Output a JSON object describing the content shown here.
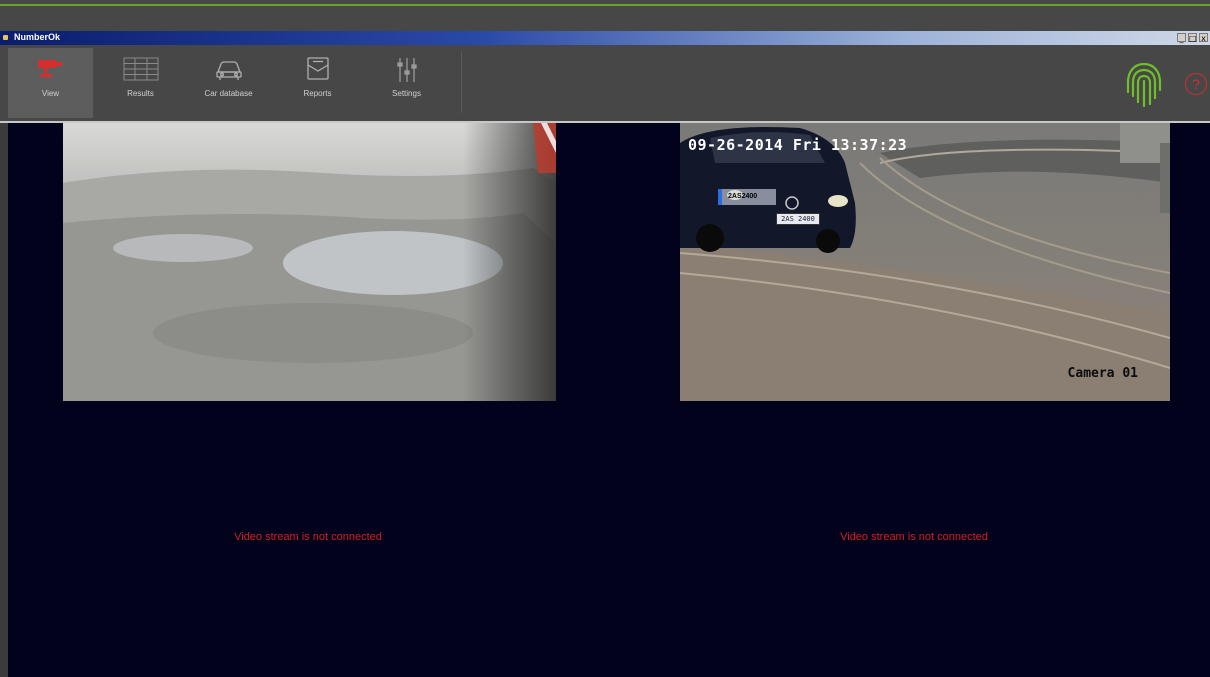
{
  "window": {
    "title": "NumberOk",
    "min": "_",
    "max": "□",
    "close": "x"
  },
  "toolbar": {
    "items": [
      {
        "label": "View",
        "icon": "camera-view-icon",
        "active": true
      },
      {
        "label": "Results",
        "icon": "results-grid-icon"
      },
      {
        "label": "Car database",
        "icon": "car-icon"
      },
      {
        "label": "Reports",
        "icon": "report-icon"
      },
      {
        "label": "Settings",
        "icon": "sliders-icon"
      }
    ],
    "right_icons": [
      "fingerprint-icon",
      "help-icon"
    ],
    "help_label": "?"
  },
  "cameras": [
    {
      "id": "feed-1",
      "type": "video",
      "scene": "wet pavement"
    },
    {
      "id": "feed-2",
      "type": "video",
      "timestamp": "09-26-2014 Fri 13:37:23",
      "camera_label": "Camera 01",
      "plate_tag": "2AS2400",
      "plate_text": "2AS 2400"
    },
    {
      "id": "feed-3",
      "status": "Video stream is not connected"
    },
    {
      "id": "feed-4",
      "status": "Video stream is not connected"
    }
  ],
  "colors": {
    "accent": "#6aa12a",
    "error": "#d2201f",
    "background": "#02021d",
    "active_icon": "#d42e2e",
    "fingerprint": "#6fbf2a"
  }
}
